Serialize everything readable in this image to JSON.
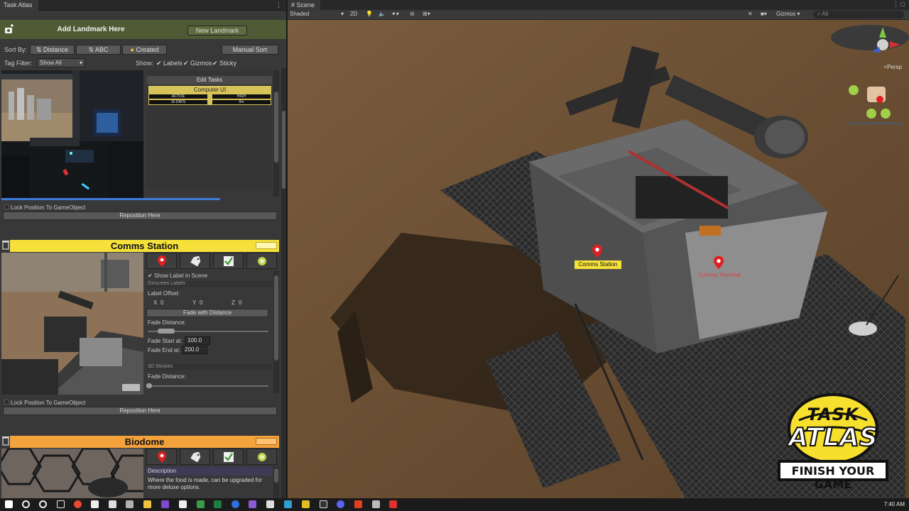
{
  "left_tab": {
    "title": "Task Atlas"
  },
  "scene_tab": {
    "title": "Scene"
  },
  "landmark": {
    "title": "Add Landmark Here",
    "new_button": "New Landmark"
  },
  "sort": {
    "label": "Sort By:",
    "distance": "Distance",
    "abc": "ABC",
    "created": "Created",
    "manual": "Manual Sort"
  },
  "tag_filter": {
    "label": "Tag Filter:",
    "value": "Show All"
  },
  "show": {
    "label": "Show:",
    "labels": "Labels",
    "gizmos": "Gizmos",
    "sticky": "Sticky"
  },
  "card1": {
    "edit_tasks": "Edit Tasks",
    "task_name": "Computer UI",
    "status": "ACTIVE",
    "priority": "HIGH",
    "duration": "10 DAYS",
    "time": "0m",
    "lock_label": "Lock Position To GameObject",
    "reposition": "Reposition Here"
  },
  "card2": {
    "title": "Comms Station",
    "show_label": "Show Label in Scene",
    "onscreen_labels": "Onscreen Labels",
    "label_offset": "Label Offset:",
    "x_label": "X",
    "x": "0",
    "y_label": "Y",
    "y": "0",
    "z_label": "Z",
    "z": "0",
    "fade_with_distance": "Fade with Distance",
    "fade_distance": "Fade Distance:",
    "fade_start_label": "Fade Start at:",
    "fade_start": "100.0",
    "fade_end_label": "Fade End at:",
    "fade_end": "200.0",
    "stickies": "3D Stickies",
    "fade_distance2": "Fade Distance:",
    "lock_label": "Lock Position To GameObject",
    "reposition": "Reposition Here"
  },
  "card3": {
    "title": "Biodome",
    "description_label": "Description",
    "description": "Where the food is made, can be upgraded for more deluxe options."
  },
  "scene_toolbar": {
    "shading": "Shaded",
    "mode_2d": "2D",
    "gizmos": "Gizmos",
    "search": "All",
    "persp": "<Persp"
  },
  "scene_labels": {
    "comms_station": "Comms Station",
    "comms_terminal": "Comms Terminal"
  },
  "logo": {
    "line1": "TASK",
    "line2": "ATLAS",
    "line3": "FINISH YOUR GAME"
  },
  "taskbar": {
    "time": "7:40 AM"
  },
  "colors": {
    "yellow_header": "#f5e13a",
    "orange_header": "#f4a23b",
    "pin_red": "#e02020",
    "landmark_green": "#505a34"
  }
}
